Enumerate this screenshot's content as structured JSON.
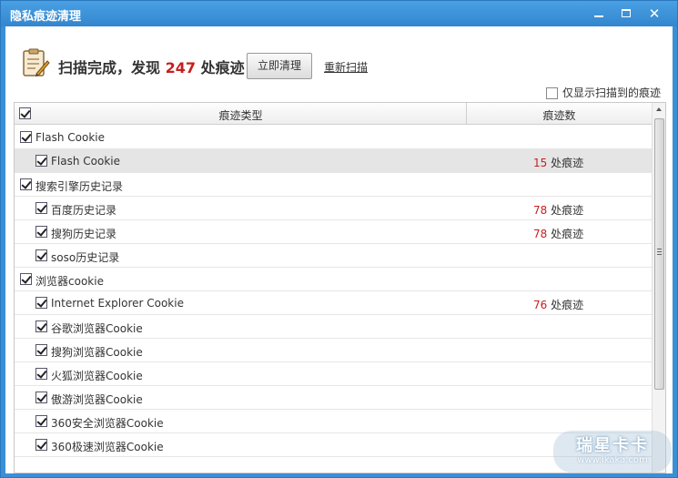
{
  "window": {
    "title": "隐私痕迹清理"
  },
  "header": {
    "status_prefix": "扫描完成，发现",
    "status_count": "247",
    "status_suffix": "处痕迹",
    "clean_button": "立即清理",
    "rescan_link": "重新扫描"
  },
  "filter": {
    "only_found_label": "仅显示扫描到的痕迹",
    "only_found_checked": false
  },
  "table": {
    "col_type": "痕迹类型",
    "col_count": "痕迹数",
    "rows": [
      {
        "level": 0,
        "label": "Flash Cookie",
        "checked": true,
        "count": "",
        "selected": false
      },
      {
        "level": 1,
        "label": "Flash Cookie",
        "checked": true,
        "count": "15",
        "selected": true
      },
      {
        "level": 0,
        "label": "搜索引擎历史记录",
        "checked": true,
        "count": "",
        "selected": false
      },
      {
        "level": 1,
        "label": "百度历史记录",
        "checked": true,
        "count": "78",
        "selected": false
      },
      {
        "level": 1,
        "label": "搜狗历史记录",
        "checked": true,
        "count": "78",
        "selected": false
      },
      {
        "level": 1,
        "label": "soso历史记录",
        "checked": true,
        "count": "",
        "selected": false
      },
      {
        "level": 0,
        "label": "浏览器cookie",
        "checked": true,
        "count": "",
        "selected": false
      },
      {
        "level": 1,
        "label": "Internet Explorer Cookie",
        "checked": true,
        "count": "76",
        "selected": false
      },
      {
        "level": 1,
        "label": "谷歌浏览器Cookie",
        "checked": true,
        "count": "",
        "selected": false
      },
      {
        "level": 1,
        "label": "搜狗浏览器Cookie",
        "checked": true,
        "count": "",
        "selected": false
      },
      {
        "level": 1,
        "label": "火狐浏览器Cookie",
        "checked": true,
        "count": "",
        "selected": false
      },
      {
        "level": 1,
        "label": "傲游浏览器Cookie",
        "checked": true,
        "count": "",
        "selected": false
      },
      {
        "level": 1,
        "label": "360安全浏览器Cookie",
        "checked": true,
        "count": "",
        "selected": false
      },
      {
        "level": 1,
        "label": "360极速浏览器Cookie",
        "checked": true,
        "count": "",
        "selected": false
      }
    ],
    "count_suffix": "处痕迹"
  },
  "watermark": {
    "main": "瑞星卡卡",
    "sub": "www.ikaka.com"
  },
  "colors": {
    "accent": "#c81e1e",
    "titlebar": "#3a8fd6"
  },
  "icons": {
    "header": "document-pencil-icon",
    "minimize": "minimize-icon",
    "maximize": "maximize-icon",
    "close": "close-icon"
  }
}
